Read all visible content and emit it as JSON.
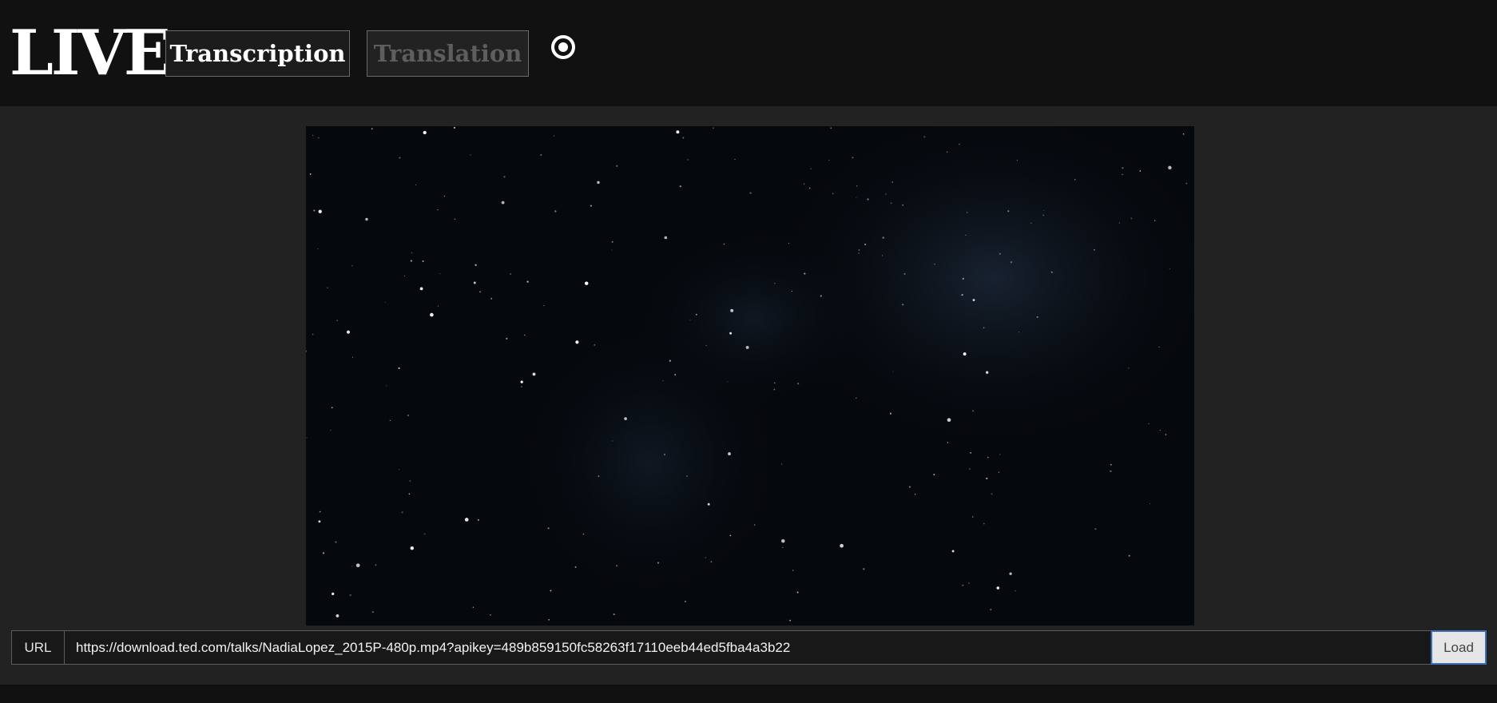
{
  "header": {
    "logo": "LIVE",
    "tabs": [
      {
        "label": "Transcription",
        "active": true
      },
      {
        "label": "Translation",
        "active": false
      }
    ],
    "record_icon": "record-icon"
  },
  "video": {
    "content": "starfield"
  },
  "url_bar": {
    "label": "URL",
    "value": "https://download.ted.com/talks/NadiaLopez_2015P-480p.mp4?apikey=489b859150fc58263f17110eeb44ed5fba4a3b22",
    "load_label": "Load"
  },
  "colors": {
    "header_bg": "#111111",
    "main_bg": "#222222",
    "load_border": "#3d6fb8"
  }
}
